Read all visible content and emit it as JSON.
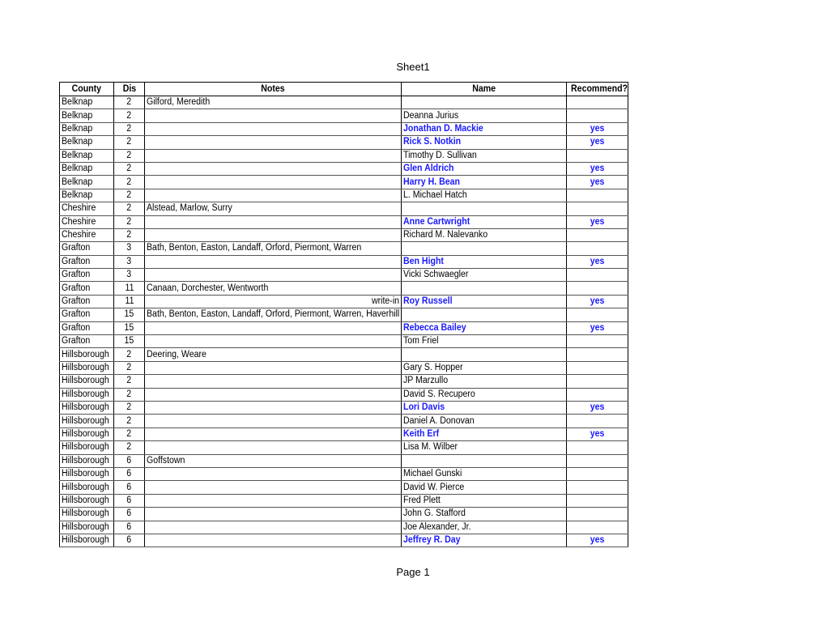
{
  "document": {
    "sheet_title": "Sheet1",
    "footer": "Page 1"
  },
  "table": {
    "headers": {
      "county": "County",
      "dis": "Dis",
      "notes": "Notes",
      "name": "Name",
      "recommend": "Recommend?"
    },
    "highlight_color": "#1a1aff",
    "rows": [
      {
        "county": "Belknap",
        "dis": "2",
        "notes": "Gilford, Meredith",
        "notes_align": "left",
        "name": "",
        "recommend": "",
        "highlight": false
      },
      {
        "county": "Belknap",
        "dis": "2",
        "notes": "",
        "notes_align": "left",
        "name": "Deanna Jurius",
        "recommend": "",
        "highlight": false
      },
      {
        "county": "Belknap",
        "dis": "2",
        "notes": "",
        "notes_align": "left",
        "name": "Jonathan D. Mackie",
        "recommend": "yes",
        "highlight": true
      },
      {
        "county": "Belknap",
        "dis": "2",
        "notes": "",
        "notes_align": "left",
        "name": "Rick S. Notkin",
        "recommend": "yes",
        "highlight": true
      },
      {
        "county": "Belknap",
        "dis": "2",
        "notes": "",
        "notes_align": "left",
        "name": "Timothy D. Sullivan",
        "recommend": "",
        "highlight": false
      },
      {
        "county": "Belknap",
        "dis": "2",
        "notes": "",
        "notes_align": "left",
        "name": "Glen Aldrich",
        "recommend": "yes",
        "highlight": true
      },
      {
        "county": "Belknap",
        "dis": "2",
        "notes": "",
        "notes_align": "left",
        "name": "Harry H. Bean",
        "recommend": "yes",
        "highlight": true
      },
      {
        "county": "Belknap",
        "dis": "2",
        "notes": "",
        "notes_align": "left",
        "name": "L. Michael Hatch",
        "recommend": "",
        "highlight": false
      },
      {
        "county": "Cheshire",
        "dis": "2",
        "notes": "Alstead, Marlow, Surry",
        "notes_align": "left",
        "name": "",
        "recommend": "",
        "highlight": false
      },
      {
        "county": "Cheshire",
        "dis": "2",
        "notes": "",
        "notes_align": "left",
        "name": "Anne Cartwright",
        "recommend": "yes",
        "highlight": true
      },
      {
        "county": "Cheshire",
        "dis": "2",
        "notes": "",
        "notes_align": "left",
        "name": "Richard  M. Nalevanko",
        "recommend": "",
        "highlight": false
      },
      {
        "county": "Grafton",
        "dis": "3",
        "notes": "Bath, Benton, Easton, Landaff, Orford, Piermont, Warren",
        "notes_align": "left",
        "name": "",
        "recommend": "",
        "highlight": false
      },
      {
        "county": "Grafton",
        "dis": "3",
        "notes": "",
        "notes_align": "left",
        "name": "Ben Hight",
        "recommend": "yes",
        "highlight": true
      },
      {
        "county": "Grafton",
        "dis": "3",
        "notes": "",
        "notes_align": "left",
        "name": "Vicki Schwaegler",
        "recommend": "",
        "highlight": false
      },
      {
        "county": "Grafton",
        "dis": "11",
        "notes": "Canaan, Dorchester, Wentworth",
        "notes_align": "left",
        "name": "",
        "recommend": "",
        "highlight": false
      },
      {
        "county": "Grafton",
        "dis": "11",
        "notes": "write-in",
        "notes_align": "right",
        "name": "Roy Russell",
        "recommend": "yes",
        "highlight": true
      },
      {
        "county": "Grafton",
        "dis": "15",
        "notes": "Bath, Benton, Easton, Landaff, Orford, Piermont, Warren, Haverhill",
        "notes_align": "left",
        "name": "",
        "recommend": "",
        "highlight": false
      },
      {
        "county": "Grafton",
        "dis": "15",
        "notes": "",
        "notes_align": "left",
        "name": "Rebecca Bailey",
        "recommend": "yes",
        "highlight": true
      },
      {
        "county": "Grafton",
        "dis": "15",
        "notes": "",
        "notes_align": "left",
        "name": "Tom Friel",
        "recommend": "",
        "highlight": false
      },
      {
        "county": "Hillsborough",
        "dis": "2",
        "notes": "Deering, Weare",
        "notes_align": "left",
        "name": "",
        "recommend": "",
        "highlight": false
      },
      {
        "county": "Hillsborough",
        "dis": "2",
        "notes": "",
        "notes_align": "left",
        "name": "Gary S. Hopper",
        "recommend": "",
        "highlight": false
      },
      {
        "county": "Hillsborough",
        "dis": "2",
        "notes": "",
        "notes_align": "left",
        "name": "JP Marzullo",
        "recommend": "",
        "highlight": false
      },
      {
        "county": "Hillsborough",
        "dis": "2",
        "notes": "",
        "notes_align": "left",
        "name": "David S. Recupero",
        "recommend": "",
        "highlight": false
      },
      {
        "county": "Hillsborough",
        "dis": "2",
        "notes": "",
        "notes_align": "left",
        "name": "Lori Davis",
        "recommend": "yes",
        "highlight": true
      },
      {
        "county": "Hillsborough",
        "dis": "2",
        "notes": "",
        "notes_align": "left",
        "name": "Daniel A. Donovan",
        "recommend": "",
        "highlight": false
      },
      {
        "county": "Hillsborough",
        "dis": "2",
        "notes": "",
        "notes_align": "left",
        "name": "Keith  Erf",
        "recommend": "yes",
        "highlight": true
      },
      {
        "county": "Hillsborough",
        "dis": "2",
        "notes": "",
        "notes_align": "left",
        "name": "Lisa M. Wilber",
        "recommend": "",
        "highlight": false
      },
      {
        "county": "Hillsborough",
        "dis": "6",
        "notes": "Goffstown",
        "notes_align": "left",
        "name": "",
        "recommend": "",
        "highlight": false
      },
      {
        "county": "Hillsborough",
        "dis": "6",
        "notes": "",
        "notes_align": "left",
        "name": "Michael Gunski",
        "recommend": "",
        "highlight": false
      },
      {
        "county": "Hillsborough",
        "dis": "6",
        "notes": "",
        "notes_align": "left",
        "name": "David W. Pierce",
        "recommend": "",
        "highlight": false
      },
      {
        "county": "Hillsborough",
        "dis": "6",
        "notes": "",
        "notes_align": "left",
        "name": "Fred Plett",
        "recommend": "",
        "highlight": false
      },
      {
        "county": "Hillsborough",
        "dis": "6",
        "notes": "",
        "notes_align": "left",
        "name": "John G. Stafford",
        "recommend": "",
        "highlight": false
      },
      {
        "county": "Hillsborough",
        "dis": "6",
        "notes": "",
        "notes_align": "left",
        "name": "Joe Alexander, Jr.",
        "recommend": "",
        "highlight": false
      },
      {
        "county": "Hillsborough",
        "dis": "6",
        "notes": "",
        "notes_align": "left",
        "name": "Jeffrey R. Day",
        "recommend": "yes",
        "highlight": true
      }
    ]
  }
}
